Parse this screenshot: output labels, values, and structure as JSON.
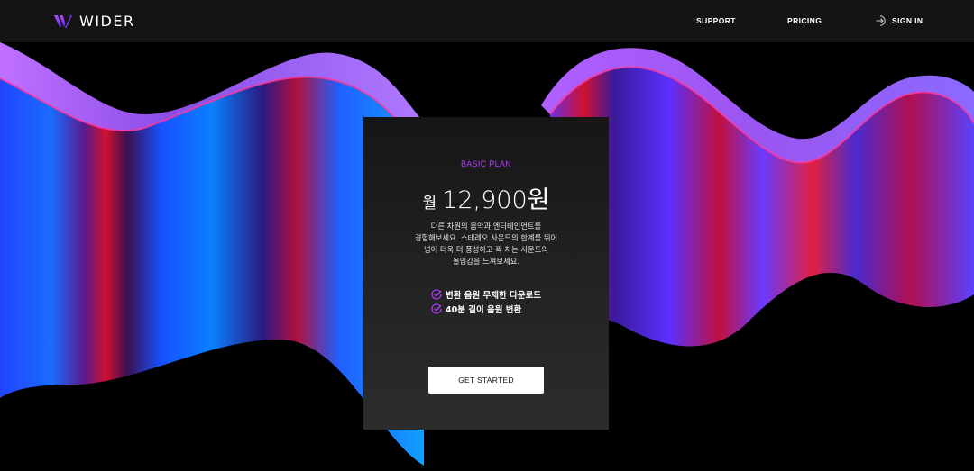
{
  "brand": {
    "name": "WIDER",
    "logo_icon": "wider-w-logo",
    "accent": "#8b3dff"
  },
  "nav": {
    "support": "SUPPORT",
    "pricing": "PRICING",
    "signin": "SIGN IN",
    "signin_icon": "sign-in-arrow-icon"
  },
  "plan": {
    "name": "BASIC PLAN",
    "price_unit": "월",
    "price_amount": "12,900원",
    "description": [
      "다른 차원의 음악과 엔터테인먼트를",
      "경험해보세요. 스테레오 사운드의 한계를 뛰어",
      "넘어 더욱 더 풍성하고 꽉 차는 사운드의",
      "몰입감을 느껴보세요."
    ],
    "features": [
      {
        "icon": "check-circle-icon",
        "text": "변환 음원 무제한 다운로드"
      },
      {
        "icon": "check-circle-icon",
        "text": "40분 길이 음원 변환"
      }
    ],
    "cta": "GET STARTED",
    "accent": "#b63cff"
  }
}
